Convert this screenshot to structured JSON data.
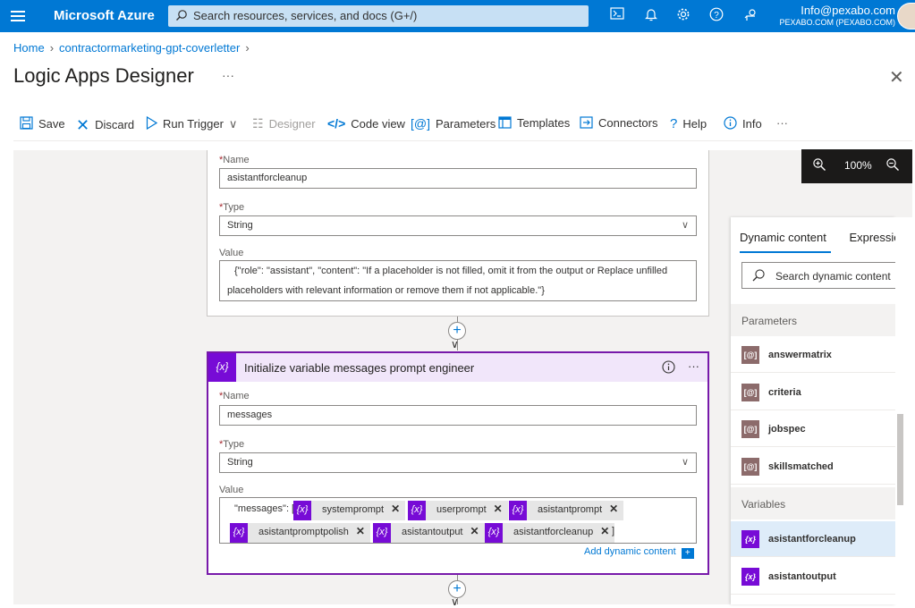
{
  "topbar": {
    "brand": "Microsoft Azure",
    "search_placeholder": "Search resources, services, and docs (G+/)",
    "account_email": "Info@pexabo.com",
    "account_tenant": "PEXABO.COM (PEXABO.COM)",
    "icons": [
      "cloud-shell-icon",
      "bell-icon",
      "gear-icon",
      "help-icon",
      "feedback-icon"
    ]
  },
  "breadcrumb": {
    "home": "Home",
    "item": "contractormarketing-gpt-coverletter"
  },
  "page_title": "Logic Apps Designer",
  "toolbar": {
    "save": "Save",
    "discard": "Discard",
    "run_trigger": "Run Trigger",
    "designer": "Designer",
    "code_view": "Code view",
    "parameters": "Parameters",
    "templates": "Templates",
    "connectors": "Connectors",
    "help": "Help",
    "info": "Info"
  },
  "zoom": {
    "level": "100%"
  },
  "card1": {
    "name_label": "Name",
    "name_value": "asistantforcleanup",
    "type_label": "Type",
    "type_value": "String",
    "value_label": "Value",
    "value_line1": "{\"role\": \"assistant\", \"content\": \"If a placeholder is not filled, omit it from the output or Replace unfilled",
    "value_line2": "placeholders with relevant information or remove them if not applicable.\"}"
  },
  "card2": {
    "title": "Initialize variable messages prompt engineer",
    "icon_text": "{x}",
    "name_label": "Name",
    "name_value": "messages",
    "type_label": "Type",
    "type_value": "String",
    "value_label": "Value",
    "value_prefix": "\"messages\": [",
    "tokens": [
      "systemprompt",
      "userprompt",
      "asistantprompt",
      "asistantpromptpolish",
      "asistantoutput",
      "asistantforcleanup"
    ],
    "value_suffix": "]",
    "add_dynamic": "Add dynamic content"
  },
  "dynamic_panel": {
    "tab_dynamic": "Dynamic content",
    "tab_expression": "Expression",
    "search_placeholder": "Search dynamic content",
    "section_parameters": "Parameters",
    "parameters": [
      "answermatrix",
      "criteria",
      "jobspec",
      "skillsmatched"
    ],
    "section_variables": "Variables",
    "variables": [
      "asistantforcleanup",
      "asistantoutput"
    ],
    "param_color": "#8c6b6b",
    "variable_color": "#770bd6"
  }
}
